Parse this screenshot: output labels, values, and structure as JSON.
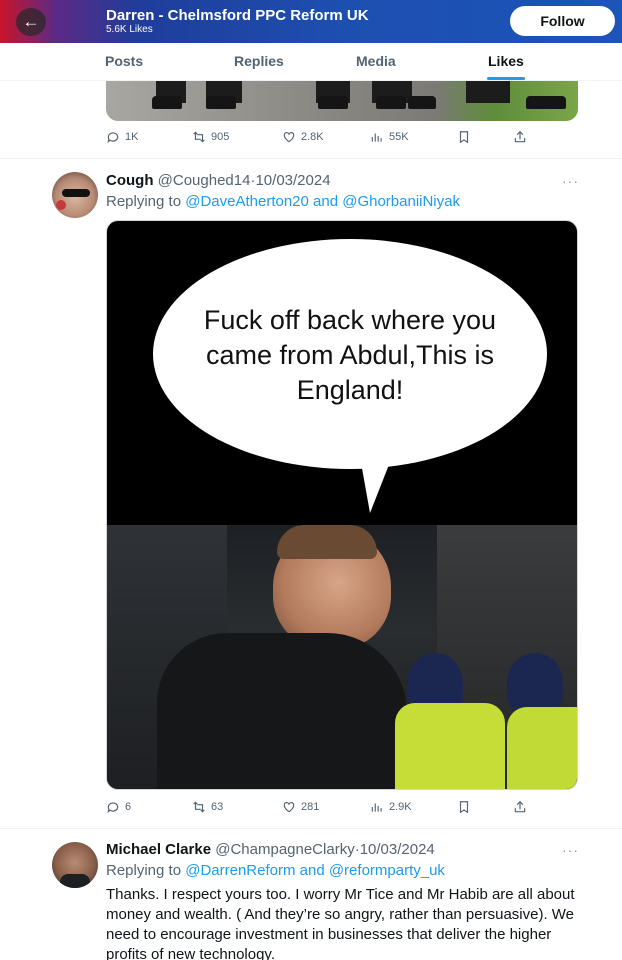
{
  "header": {
    "title": "Darren - Chelmsford PPC Reform UK",
    "likes": "5.6K Likes",
    "follow_label": "Follow"
  },
  "tabs": [
    {
      "label": "Posts"
    },
    {
      "label": "Replies"
    },
    {
      "label": "Media"
    },
    {
      "label": "Likes",
      "active": true
    }
  ],
  "tweets": [
    {
      "stats": {
        "replies": "1K",
        "reposts": "905",
        "likes": "2.8K",
        "views": "55K"
      }
    },
    {
      "name": "Cough",
      "handle": "@Coughed14",
      "date": "10/03/2024",
      "replying_prefix": "Replying to",
      "replying_to": "@DaveAtherton20 and @GhorbaniiNiyak",
      "media_text": "Fuck off back where you came from Abdul,This is England!",
      "stats": {
        "replies": "6",
        "reposts": "63",
        "likes": "281",
        "views": "2.9K"
      }
    },
    {
      "name": "Michael Clarke",
      "handle": "@ChampagneClarky",
      "date": "10/03/2024",
      "replying_prefix": "Replying to",
      "replying_to": "@DarrenReform and @reformparty_uk",
      "text": "Thanks. I respect yours too. I worry Mr Tice and Mr Habib are all about money and wealth. ( And they’re so angry, rather than persuasive). We need to encourage investment in businesses that deliver the higher profits of new technology."
    }
  ],
  "icons": {
    "back": "arrow-left-icon",
    "reply": "reply-icon",
    "repost": "repost-icon",
    "like": "heart-icon",
    "views": "views-icon",
    "bookmark": "bookmark-icon",
    "share": "share-icon",
    "more": "more-icon"
  },
  "colors": {
    "accent": "#1d9bf0",
    "muted": "#536471",
    "text": "#0f1419"
  }
}
